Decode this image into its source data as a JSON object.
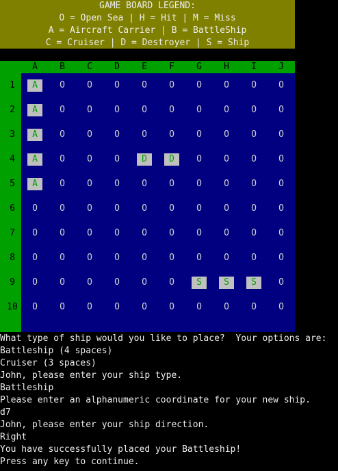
{
  "legend": {
    "lines": [
      "GAME BOARD LEGEND:",
      "O = Open Sea | H = Hit | M = Miss",
      "A = Aircraft Carrier | B = BattleShip",
      "C = Cruiser | D = Destroyer | S = Ship"
    ]
  },
  "board": {
    "columns": [
      "A",
      "B",
      "C",
      "D",
      "E",
      "F",
      "G",
      "H",
      "I",
      "J"
    ],
    "rows": [
      "1",
      "2",
      "3",
      "4",
      "5",
      "6",
      "7",
      "8",
      "9",
      "10"
    ],
    "cells": [
      [
        "A",
        "O",
        "O",
        "O",
        "O",
        "O",
        "O",
        "O",
        "O",
        "O"
      ],
      [
        "A",
        "O",
        "O",
        "O",
        "O",
        "O",
        "O",
        "O",
        "O",
        "O"
      ],
      [
        "A",
        "O",
        "O",
        "O",
        "O",
        "O",
        "O",
        "O",
        "O",
        "O"
      ],
      [
        "A",
        "O",
        "O",
        "O",
        "D",
        "D",
        "O",
        "O",
        "O",
        "O"
      ],
      [
        "A",
        "O",
        "O",
        "O",
        "O",
        "O",
        "O",
        "O",
        "O",
        "O"
      ],
      [
        "O",
        "O",
        "O",
        "O",
        "O",
        "O",
        "O",
        "O",
        "O",
        "O"
      ],
      [
        "O",
        "O",
        "O",
        "O",
        "O",
        "O",
        "O",
        "O",
        "O",
        "O"
      ],
      [
        "O",
        "O",
        "O",
        "O",
        "O",
        "O",
        "O",
        "O",
        "O",
        "O"
      ],
      [
        "O",
        "O",
        "O",
        "O",
        "O",
        "O",
        "S",
        "S",
        "S",
        "O"
      ],
      [
        "O",
        "O",
        "O",
        "O",
        "O",
        "O",
        "O",
        "O",
        "O",
        "O"
      ]
    ]
  },
  "console": {
    "lines": [
      "What type of ship would you like to place?  Your options are:",
      "Battleship (4 spaces)",
      "Cruiser (3 spaces)",
      "John, please enter your ship type.",
      "Battleship",
      "Please enter an alphanumeric coordinate for your new ship.",
      "d7",
      "John, please enter your ship direction.",
      "Right",
      "You have successfully placed your Battleship!",
      "Press any key to continue."
    ]
  },
  "colors": {
    "legend_bg": "#808000",
    "header_bg": "#00a000",
    "grid_bg": "#000080",
    "ship_bg": "#c0c0c0",
    "ship_fg": "#00a000",
    "console_fg": "#ececec"
  }
}
